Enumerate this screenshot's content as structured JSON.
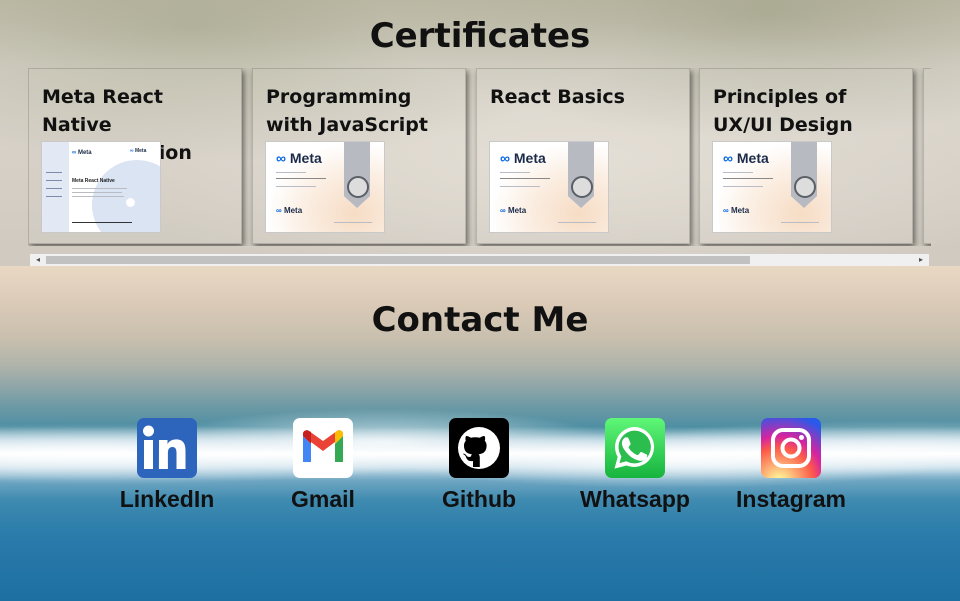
{
  "certificates": {
    "title": "Certificates",
    "cards": [
      {
        "title": "Meta React Native Specialization",
        "thumb_heading": "Meta React Native"
      },
      {
        "title": "Programming with JavaScript",
        "thumb_logo": "Meta"
      },
      {
        "title": "React Basics",
        "thumb_logo": "Meta"
      },
      {
        "title": "Principles of UX/UI Design",
        "thumb_logo": "Meta"
      }
    ],
    "meta_infinity": "∞",
    "scroll_left_glyph": "◂",
    "scroll_right_glyph": "▸"
  },
  "contact": {
    "title": "Contact Me",
    "links": [
      {
        "label": "LinkedIn",
        "icon": "linkedin-icon",
        "color": "#2d64bc"
      },
      {
        "label": "Gmail",
        "icon": "gmail-icon",
        "color": "#ffffff"
      },
      {
        "label": "Github",
        "icon": "github-icon",
        "color": "#000000"
      },
      {
        "label": "Whatsapp",
        "icon": "whatsapp-icon",
        "color": "#25d366"
      },
      {
        "label": "Instagram",
        "icon": "instagram-icon",
        "color": "#d6249f"
      }
    ]
  }
}
